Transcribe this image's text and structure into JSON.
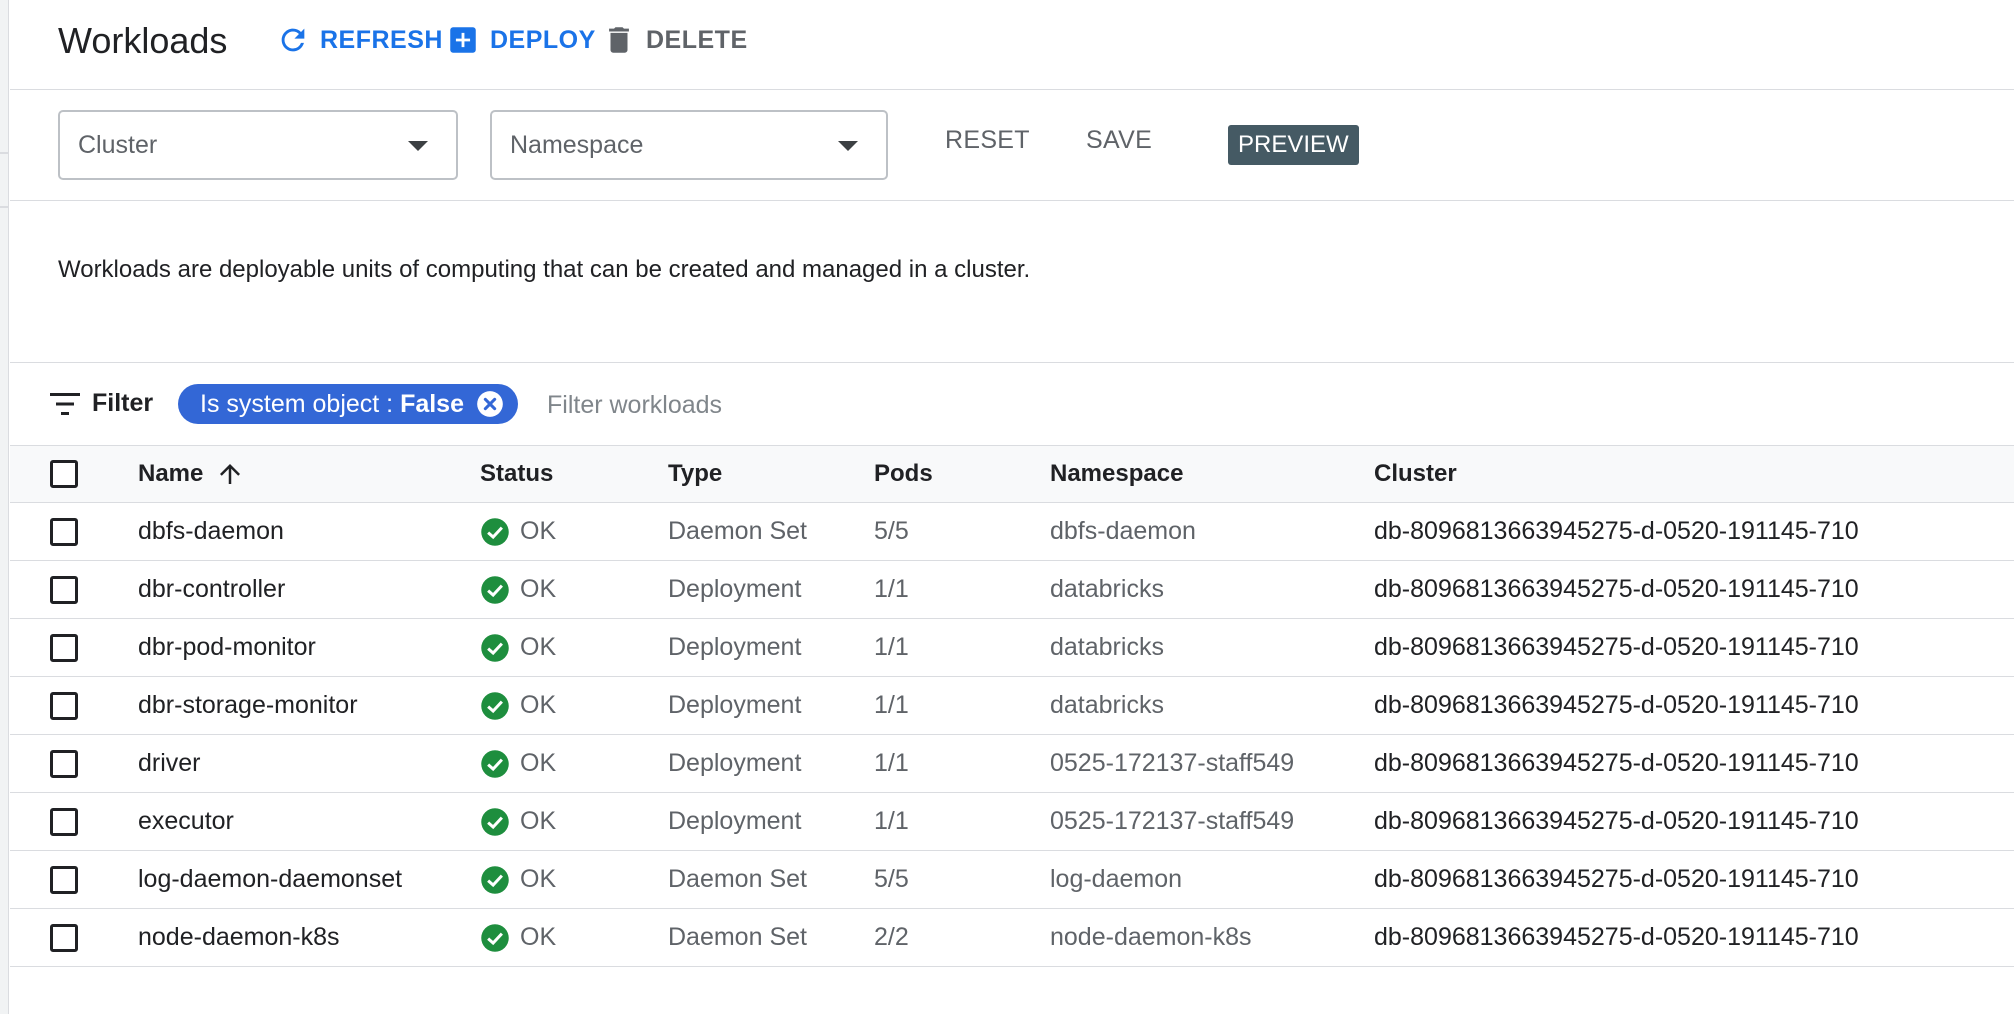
{
  "header": {
    "title": "Workloads",
    "refresh_label": "REFRESH",
    "deploy_label": "DEPLOY",
    "delete_label": "DELETE"
  },
  "filters": {
    "cluster_placeholder": "Cluster",
    "namespace_placeholder": "Namespace",
    "reset_label": "RESET",
    "save_label": "SAVE",
    "preview_label": "PREVIEW"
  },
  "description": "Workloads are deployable units of computing that can be created and managed in a cluster.",
  "filter_bar": {
    "label": "Filter",
    "chip_key": "Is system object : ",
    "chip_value": "False",
    "placeholder": "Filter workloads"
  },
  "table": {
    "columns": [
      "Name",
      "Status",
      "Type",
      "Pods",
      "Namespace",
      "Cluster"
    ],
    "sort_column": "Name",
    "sort_direction": "ascending",
    "rows": [
      {
        "name": "dbfs-daemon",
        "status": "OK",
        "type": "Daemon Set",
        "pods": "5/5",
        "namespace": "dbfs-daemon",
        "cluster": "db-8096813663945275-d-0520-191145-710"
      },
      {
        "name": "dbr-controller",
        "status": "OK",
        "type": "Deployment",
        "pods": "1/1",
        "namespace": "databricks",
        "cluster": "db-8096813663945275-d-0520-191145-710"
      },
      {
        "name": "dbr-pod-monitor",
        "status": "OK",
        "type": "Deployment",
        "pods": "1/1",
        "namespace": "databricks",
        "cluster": "db-8096813663945275-d-0520-191145-710"
      },
      {
        "name": "dbr-storage-monitor",
        "status": "OK",
        "type": "Deployment",
        "pods": "1/1",
        "namespace": "databricks",
        "cluster": "db-8096813663945275-d-0520-191145-710"
      },
      {
        "name": "driver",
        "status": "OK",
        "type": "Deployment",
        "pods": "1/1",
        "namespace": "0525-172137-staff549",
        "cluster": "db-8096813663945275-d-0520-191145-710"
      },
      {
        "name": "executor",
        "status": "OK",
        "type": "Deployment",
        "pods": "1/1",
        "namespace": "0525-172137-staff549",
        "cluster": "db-8096813663945275-d-0520-191145-710"
      },
      {
        "name": "log-daemon-daemonset",
        "status": "OK",
        "type": "Daemon Set",
        "pods": "5/5",
        "namespace": "log-daemon",
        "cluster": "db-8096813663945275-d-0520-191145-710"
      },
      {
        "name": "node-daemon-k8s",
        "status": "OK",
        "type": "Daemon Set",
        "pods": "2/2",
        "namespace": "node-daemon-k8s",
        "cluster": "db-8096813663945275-d-0520-191145-710"
      }
    ]
  },
  "icons": {
    "refresh": "refresh-icon",
    "deploy": "add-box-icon",
    "delete": "trash-icon",
    "filter": "filter-list-icon",
    "chip_remove": "cancel-icon",
    "status_ok": "check-circle-icon",
    "sort": "arrow-up-icon"
  },
  "colors": {
    "accent": "#1a73e8",
    "chip": "#3367d6",
    "ok": "#1e8e3e",
    "preview_badge": "#455a64"
  }
}
